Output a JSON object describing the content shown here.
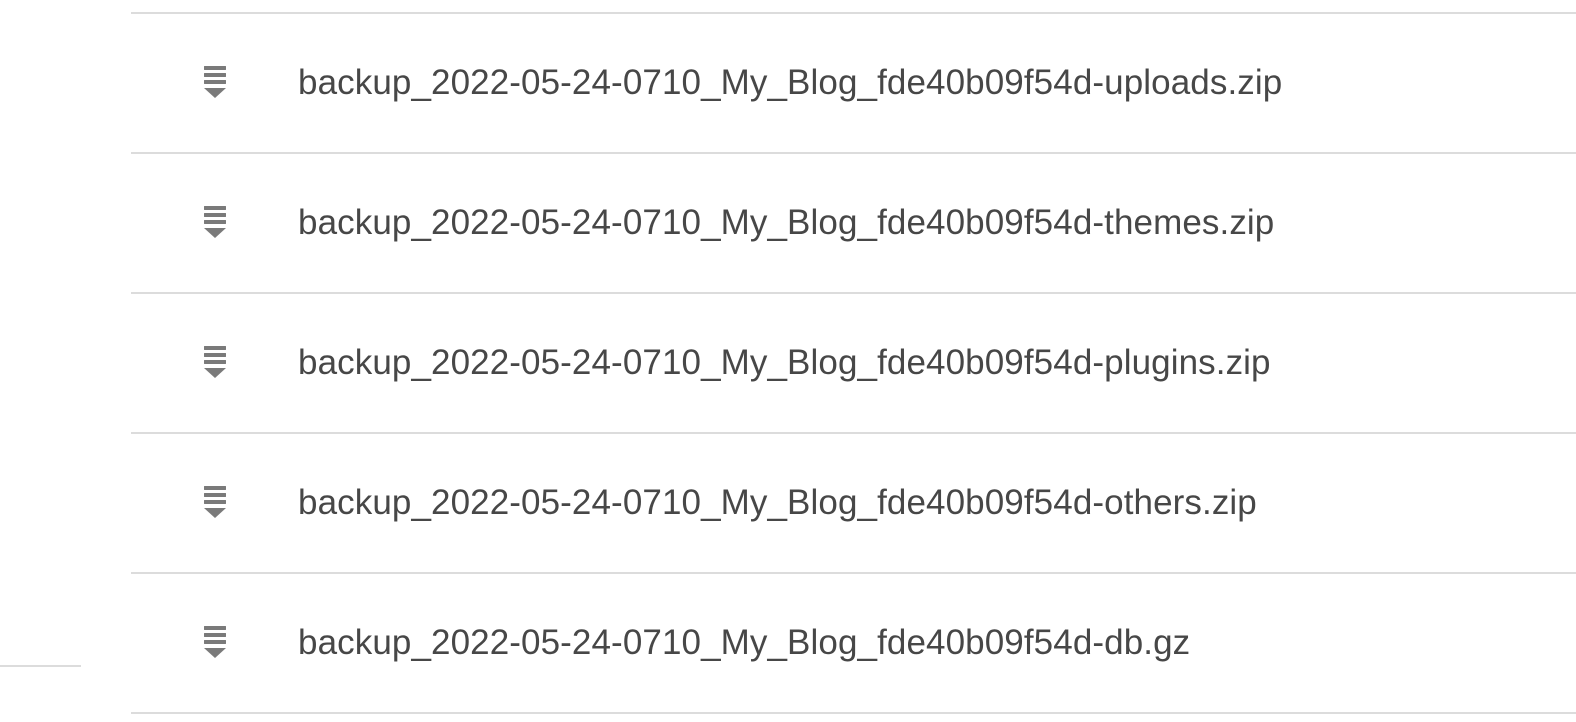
{
  "files": [
    {
      "name": "backup_2022-05-24-0710_My_Blog_fde40b09f54d-uploads.zip",
      "icon": "archive-file-icon"
    },
    {
      "name": "backup_2022-05-24-0710_My_Blog_fde40b09f54d-themes.zip",
      "icon": "archive-file-icon"
    },
    {
      "name": "backup_2022-05-24-0710_My_Blog_fde40b09f54d-plugins.zip",
      "icon": "archive-file-icon"
    },
    {
      "name": "backup_2022-05-24-0710_My_Blog_fde40b09f54d-others.zip",
      "icon": "archive-file-icon"
    },
    {
      "name": "backup_2022-05-24-0710_My_Blog_fde40b09f54d-db.gz",
      "icon": "archive-file-icon"
    }
  ],
  "colors": {
    "text": "#474747",
    "icon": "#7a7a7a",
    "divider": "#dcdcdc"
  }
}
